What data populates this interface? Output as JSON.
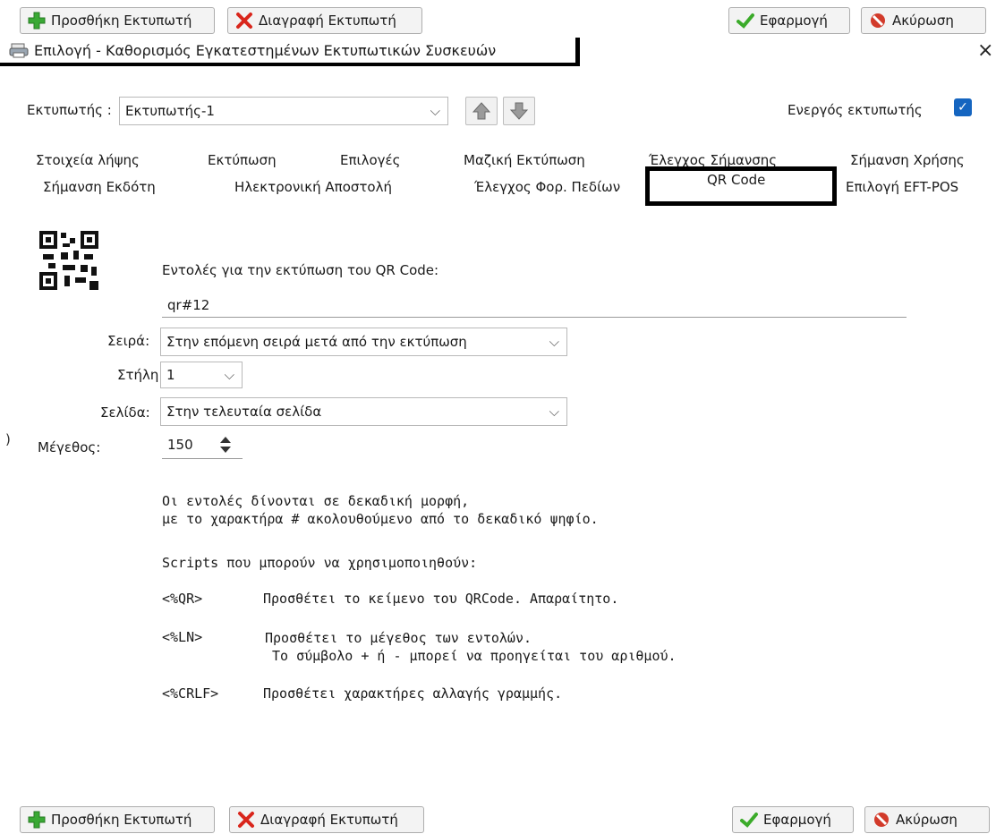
{
  "top_toolbar": {
    "add_printer": "Προσθήκη Εκτυπωτή",
    "delete_printer": "Διαγραφή Εκτυπωτή",
    "apply": "Εφαρμογή",
    "cancel": "Ακύρωση"
  },
  "window": {
    "title": "Επιλογή - Καθορισμός Εγκατεστημένων Εκτυπωτικών Συσκευών",
    "close_glyph": "×"
  },
  "printer_row": {
    "label": "Εκτυπωτής :",
    "selected": "Εκτυπωτής-1",
    "active_label": "Ενεργός εκτυπωτής",
    "active_checked": true
  },
  "tabs": {
    "row1": [
      "Στοιχεία λήψης",
      "Εκτύπωση",
      "Επιλογές",
      "Μαζική Εκτύπωση",
      "Έλεγχος Σήμανσης",
      "Σήμανση Χρήσης"
    ],
    "row2": [
      "Σήμανση Εκδότη",
      "Ηλεκτρονική Αποστολή",
      "Έλεγχος Φορ. Πεδίων",
      "QR Code",
      "Επιλογή EFT-POS"
    ],
    "selected": "QR Code"
  },
  "qr": {
    "commands_label": "Εντολές για την εκτύπωση του QR Code:",
    "commands_value": "qr#12",
    "row_label": "Σειρά:",
    "row_value": "Στην επόμενη σειρά μετά από την εκτύπωση",
    "column_label": "Στήλη:",
    "column_value": "1",
    "page_label": "Σελίδα:",
    "page_value": "Στην τελευταία σελίδα",
    "size_label": "Μέγεθος:",
    "size_value": "150",
    "left_marker": ")"
  },
  "help": {
    "line1": "Οι εντολές δίνονται σε δεκαδική μορφή,",
    "line2": "με το χαρακτήρα # ακολουθούμενο από το δεκαδικό ψηφίο.",
    "scripts_title": "Scripts που μπορούν να χρησιμοποιηθούν:",
    "qr_code": "<%QR>",
    "qr_desc": "Προσθέτει το κείμενο του QRCode. Απαραίτητο.",
    "ln_code": "<%LN>",
    "ln_desc1": "Προσθέτει το μέγεθος των εντολών.",
    "ln_desc2": "Το σύμβολο + ή - μπορεί να προηγείται του αριθμού.",
    "crlf_code": "<%CRLF>",
    "crlf_desc": "Προσθέτει χαρακτήρες αλλαγής γραμμής."
  },
  "bottom_toolbar": {
    "add_printer": "Προσθήκη Εκτυπωτή",
    "delete_printer": "Διαγραφή Εκτυπωτή",
    "apply": "Εφαρμογή",
    "cancel": "Ακύρωση"
  },
  "colors": {
    "checkbox": "#1565c0",
    "plus_green": "#3aa935",
    "delete_red": "#d9261c",
    "check_green": "#3bab2a",
    "cancel_red": "#d23a2a"
  }
}
